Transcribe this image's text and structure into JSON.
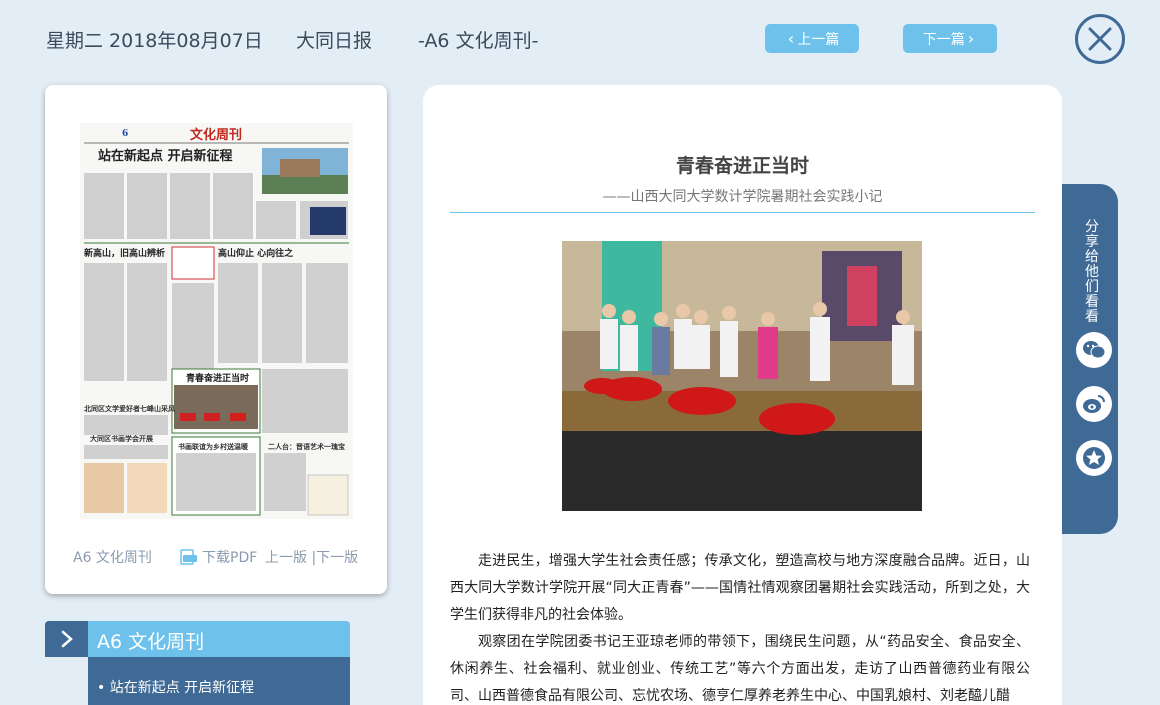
{
  "header": {
    "date": "星期二 2018年08月07日",
    "paper_name": "大同日报",
    "section": "-A6 文化周刊-",
    "prev_label": "上一篇",
    "next_label": "下一篇"
  },
  "preview": {
    "thumb_page_no": "6",
    "thumb_masthead": "文化周刊",
    "thumb_headline": "站在新起点  开启新征程",
    "section_label": "A6 文化周刊",
    "pdf_label": "下载PDF",
    "pages_label": "上一版 |下一版"
  },
  "article_list": {
    "section_title": "A6  文化周刊",
    "items": [
      "• 站在新起点 开启新征程"
    ]
  },
  "article": {
    "title": "青春奋进正当时",
    "subtitle": "——山西大同大学数计学院暑期社会实践小记",
    "paragraphs": [
      "走进民生，增强大学生社会责任感；传承文化，塑造高校与地方深度融合品牌。近日，山西大同大学数计学院开展“同大正青春”——国情社情观察团暑期社会实践活动，所到之处，大学生们获得非凡的社会体验。",
      "观察团在学院团委书记王亚琼老师的带领下，围绕民生问题，从“药品安全、食品安全、休闲养生、社会福利、就业创业、传统工艺”等六个方面出发，走访了山西普德药业有限公司、山西普德食品有限公司、忘忧农场、德亨仁厚养老养生中心、中国乳娘村、刘老醯儿醋"
    ]
  },
  "share": {
    "label": "分享给他们看看"
  },
  "colors": {
    "background": "#e3edf5",
    "accent_blue": "#6ec1ea",
    "dark_blue": "#3f6a96"
  }
}
